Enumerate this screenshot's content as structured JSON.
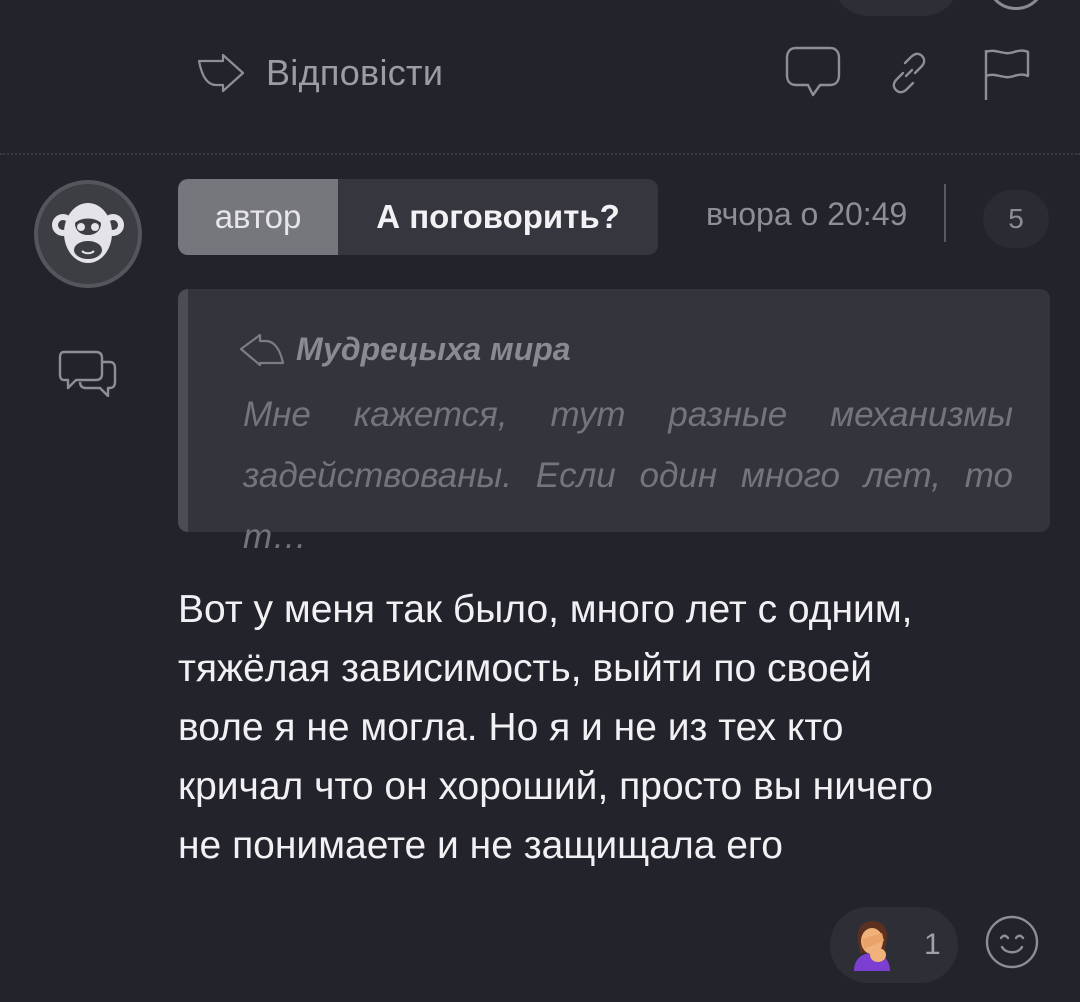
{
  "actions": {
    "reply_label": "Відповісти"
  },
  "comment": {
    "author_badge": "автор",
    "title": "А поговорить?",
    "timestamp": "вчора о 20:49",
    "count": "5",
    "quote": {
      "author": "Мудрецыха мира",
      "text": "Мне кажется, тут разные механизмы задействованы. Если один много лет, то т…"
    },
    "body": "Вот у меня так было, много лет с одним,\nтяжёлая зависимость, выйти по своей\nволе я не могла. Но я и не из тех кто\nкричал что он хороший, просто вы ничего\nне понимаете и не защищала его",
    "reaction": {
      "emoji": "facepalm-woman-icon",
      "count": "1"
    }
  },
  "colors": {
    "background": "#23232b",
    "badge": "#76767d",
    "quote_bg": "#34343d"
  }
}
